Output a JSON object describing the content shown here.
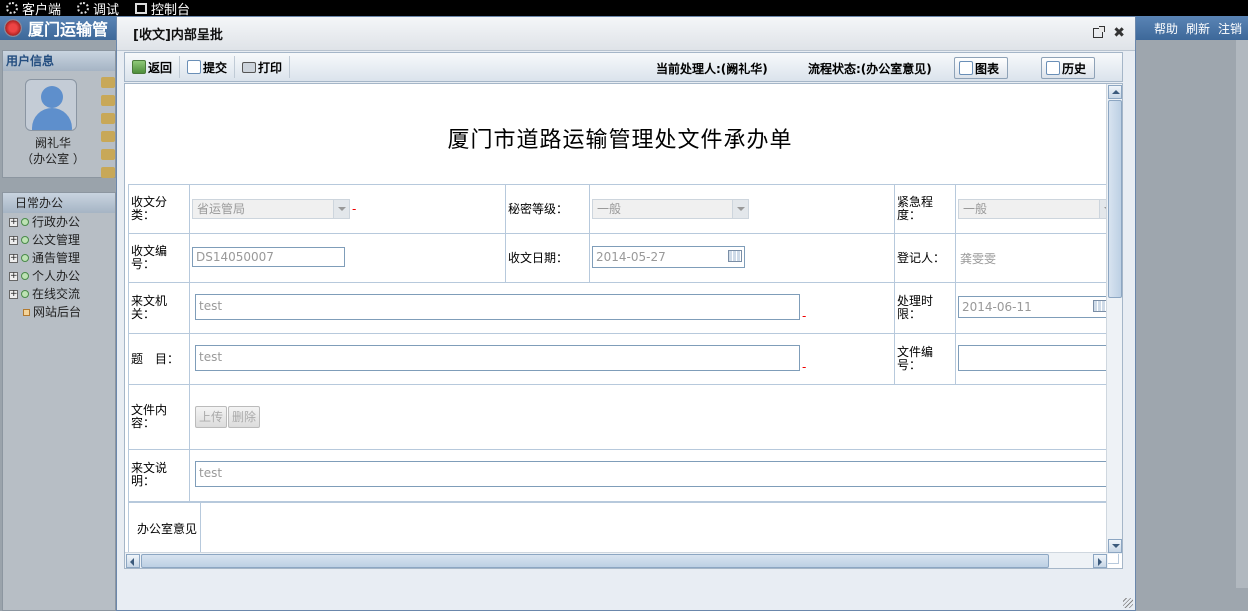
{
  "sysbar": {
    "items": [
      "客户端",
      "调试",
      "控制台"
    ]
  },
  "app": {
    "title": "厦门运输管",
    "links": [
      "帮助",
      "刷新",
      "注销"
    ]
  },
  "sidebar": {
    "user_section_title": "用户信息",
    "user_name": "阙礼华",
    "user_dept": "（办公室 ）",
    "nav_title": "日常办公",
    "tree": [
      {
        "label": "行政办公",
        "type": "folder"
      },
      {
        "label": "公文管理",
        "type": "folder"
      },
      {
        "label": "通告管理",
        "type": "folder"
      },
      {
        "label": "个人办公",
        "type": "folder"
      },
      {
        "label": "在线交流",
        "type": "folder"
      },
      {
        "label": "网站后台",
        "type": "leaf"
      }
    ]
  },
  "dialog": {
    "title": "[收文]内部呈批",
    "toolbar": {
      "back_label": "返回",
      "submit_label": "提交",
      "print_label": "打印",
      "handler_text": "当前处理人:(阙礼华)",
      "status_text": "流程状态:(办公室意见)",
      "chart_label": "图表",
      "history_label": "历史"
    },
    "document": {
      "title": "厦门市道路运输管理处文件承办单",
      "fields": {
        "category_label": "收文分类：",
        "category_value": "省运管局",
        "secret_label": "秘密等级：",
        "secret_value": "一般",
        "urgency_label": "紧急程度：",
        "urgency_value": "一般",
        "number_label": "收文编号：",
        "number_value": "DS14050007",
        "date_label": "收文日期：",
        "date_value": "2014-05-27",
        "registrar_label": "登记人：",
        "registrar_value": "龚雯雯",
        "source_label": "来文机关：",
        "source_value": "test",
        "deadline_label": "处理时限：",
        "deadline_value": "2014-06-11",
        "subject_label": "题　目：",
        "subject_value": "test",
        "file_no_label": "文件编号：",
        "file_no_value": "",
        "content_label": "文件内容：",
        "upload_label": "上传",
        "delete_label": "删除",
        "note_label": "来文说明：",
        "note_value": "test",
        "opinion_label": "办公室意见"
      }
    }
  }
}
